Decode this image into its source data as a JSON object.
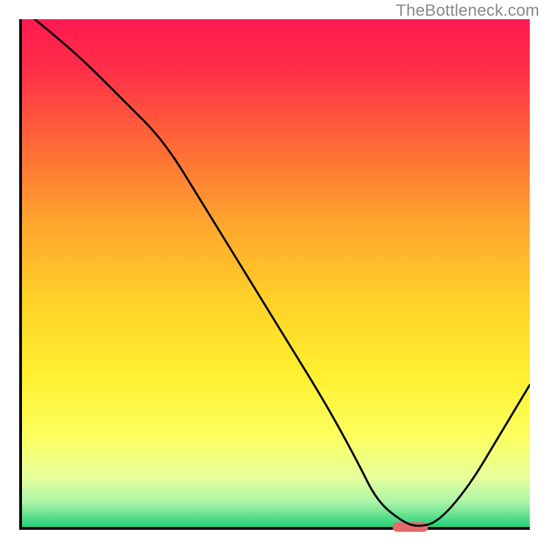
{
  "watermark": "TheBottleneck.com",
  "chart_data": {
    "type": "line",
    "title": "",
    "xlabel": "",
    "ylabel": "",
    "xlim": [
      0,
      100
    ],
    "ylim": [
      0,
      100
    ],
    "x": [
      0,
      5,
      12,
      20,
      28,
      36,
      44,
      52,
      60,
      66,
      70,
      75,
      78,
      82,
      88,
      94,
      100
    ],
    "values": [
      102,
      98,
      92,
      84,
      76,
      63,
      50,
      37,
      24,
      13,
      5,
      1,
      0,
      1,
      8,
      18,
      28
    ],
    "marker": {
      "x_start": 73,
      "x_end": 80,
      "y": 0
    },
    "background_gradient": {
      "stops": [
        {
          "offset": 0.0,
          "color": "#ff1951"
        },
        {
          "offset": 0.1,
          "color": "#ff2f48"
        },
        {
          "offset": 0.25,
          "color": "#ff6a36"
        },
        {
          "offset": 0.4,
          "color": "#ffa52e"
        },
        {
          "offset": 0.55,
          "color": "#ffd028"
        },
        {
          "offset": 0.7,
          "color": "#fff030"
        },
        {
          "offset": 0.82,
          "color": "#fcff5e"
        },
        {
          "offset": 0.9,
          "color": "#e8ff9a"
        },
        {
          "offset": 0.95,
          "color": "#aef5a8"
        },
        {
          "offset": 1.0,
          "color": "#24cf7a"
        }
      ]
    }
  }
}
